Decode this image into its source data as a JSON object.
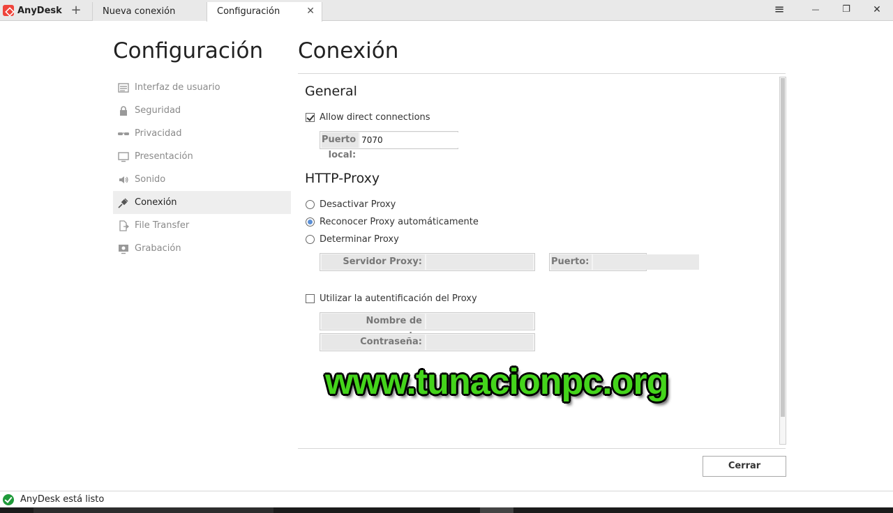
{
  "app": {
    "name": "AnyDesk",
    "new_tab_symbol": "+"
  },
  "tabs": [
    {
      "label": "Nueva conexión",
      "active": false
    },
    {
      "label": "Configuración",
      "active": true,
      "close_symbol": "✕"
    }
  ],
  "window_controls": {
    "menu": "≡",
    "minimize": "—",
    "restore": "❐",
    "close": "✕"
  },
  "sidebar": {
    "title": "Configuración",
    "items": [
      {
        "label": "Interfaz de usuario",
        "icon": "window-icon",
        "selected": false
      },
      {
        "label": "Seguridad",
        "icon": "lock-icon",
        "selected": false
      },
      {
        "label": "Privacidad",
        "icon": "glasses-icon",
        "selected": false
      },
      {
        "label": "Presentación",
        "icon": "monitor-icon",
        "selected": false
      },
      {
        "label": "Sonido",
        "icon": "speaker-icon",
        "selected": false
      },
      {
        "label": "Conexión",
        "icon": "plug-icon",
        "selected": true
      },
      {
        "label": "File Transfer",
        "icon": "file-transfer-icon",
        "selected": false
      },
      {
        "label": "Grabación",
        "icon": "recording-icon",
        "selected": false
      }
    ]
  },
  "main": {
    "title": "Conexión",
    "general": {
      "heading": "General",
      "allow_direct": {
        "label": "Allow direct connections",
        "checked": true
      },
      "local_port": {
        "label": "Puerto local:",
        "value": "7070"
      }
    },
    "proxy": {
      "heading": "HTTP-Proxy",
      "options": [
        {
          "label": "Desactivar Proxy",
          "selected": false
        },
        {
          "label": "Reconocer Proxy automáticamente",
          "selected": true
        },
        {
          "label": "Determinar Proxy",
          "selected": false
        }
      ],
      "server": {
        "label": "Servidor Proxy:",
        "value": ""
      },
      "port": {
        "label": "Puerto:",
        "value": ""
      },
      "auth": {
        "label": "Utilizar la autentificación del Proxy",
        "checked": false
      },
      "username": {
        "label": "Nombre de usuario:",
        "value": ""
      },
      "password": {
        "label": "Contraseña:",
        "value": ""
      }
    },
    "close_button": "Cerrar"
  },
  "watermark": "www.tunacionpc.org",
  "status": {
    "text": "AnyDesk está listo"
  },
  "colors": {
    "brand": "#ef443b",
    "status_ok": "#1f9a3a",
    "radio_on": "#5a8fd6",
    "watermark": "#44d41b"
  }
}
